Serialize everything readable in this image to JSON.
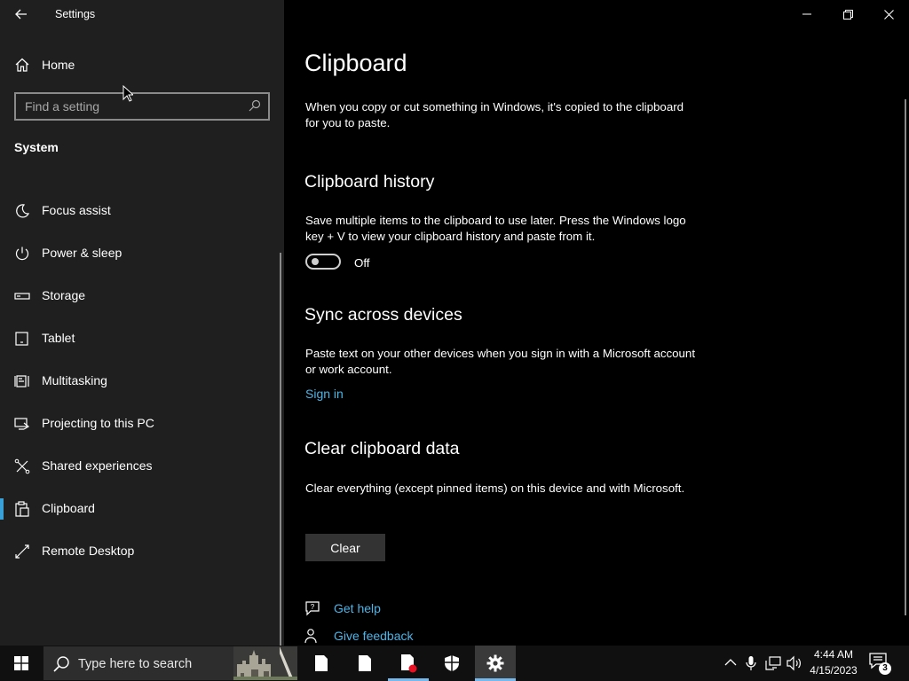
{
  "app": {
    "title": "Settings"
  },
  "sidebar": {
    "home_label": "Home",
    "search_placeholder": "Find a setting",
    "section_label": "System",
    "items": [
      {
        "label": "Focus assist",
        "icon": "moon-icon"
      },
      {
        "label": "Power & sleep",
        "icon": "power-icon"
      },
      {
        "label": "Storage",
        "icon": "storage-icon"
      },
      {
        "label": "Tablet",
        "icon": "tablet-icon"
      },
      {
        "label": "Multitasking",
        "icon": "multitasking-icon"
      },
      {
        "label": "Projecting to this PC",
        "icon": "projecting-icon"
      },
      {
        "label": "Shared experiences",
        "icon": "shared-experiences-icon"
      },
      {
        "label": "Clipboard",
        "icon": "clipboard-icon",
        "selected": true
      },
      {
        "label": "Remote Desktop",
        "icon": "remote-desktop-icon"
      }
    ]
  },
  "main": {
    "title": "Clipboard",
    "intro": "When you copy or cut something in Windows, it's copied to the clipboard for you to paste.",
    "history": {
      "heading": "Clipboard history",
      "description": "Save multiple items to the clipboard to use later. Press the Windows logo key + V to view your clipboard history and paste from it.",
      "toggle_state": "Off"
    },
    "sync": {
      "heading": "Sync across devices",
      "description": "Paste text on your other devices when you sign in with a Microsoft account or work account.",
      "link": "Sign in"
    },
    "clear": {
      "heading": "Clear clipboard data",
      "description": "Clear everything (except pinned items) on this device and with Microsoft.",
      "button": "Clear"
    },
    "help_links": [
      {
        "label": "Get help",
        "icon": "help-chat-icon"
      },
      {
        "label": "Give feedback",
        "icon": "feedback-icon"
      }
    ]
  },
  "taskbar": {
    "search_placeholder": "Type here to search",
    "time": "4:44 AM",
    "date": "4/15/2023",
    "notification_count": "3"
  },
  "colors": {
    "accent": "#3aa0d8",
    "link": "#4cb4e7",
    "sidebar_bg": "#1f1f1f",
    "main_bg": "#000000"
  }
}
